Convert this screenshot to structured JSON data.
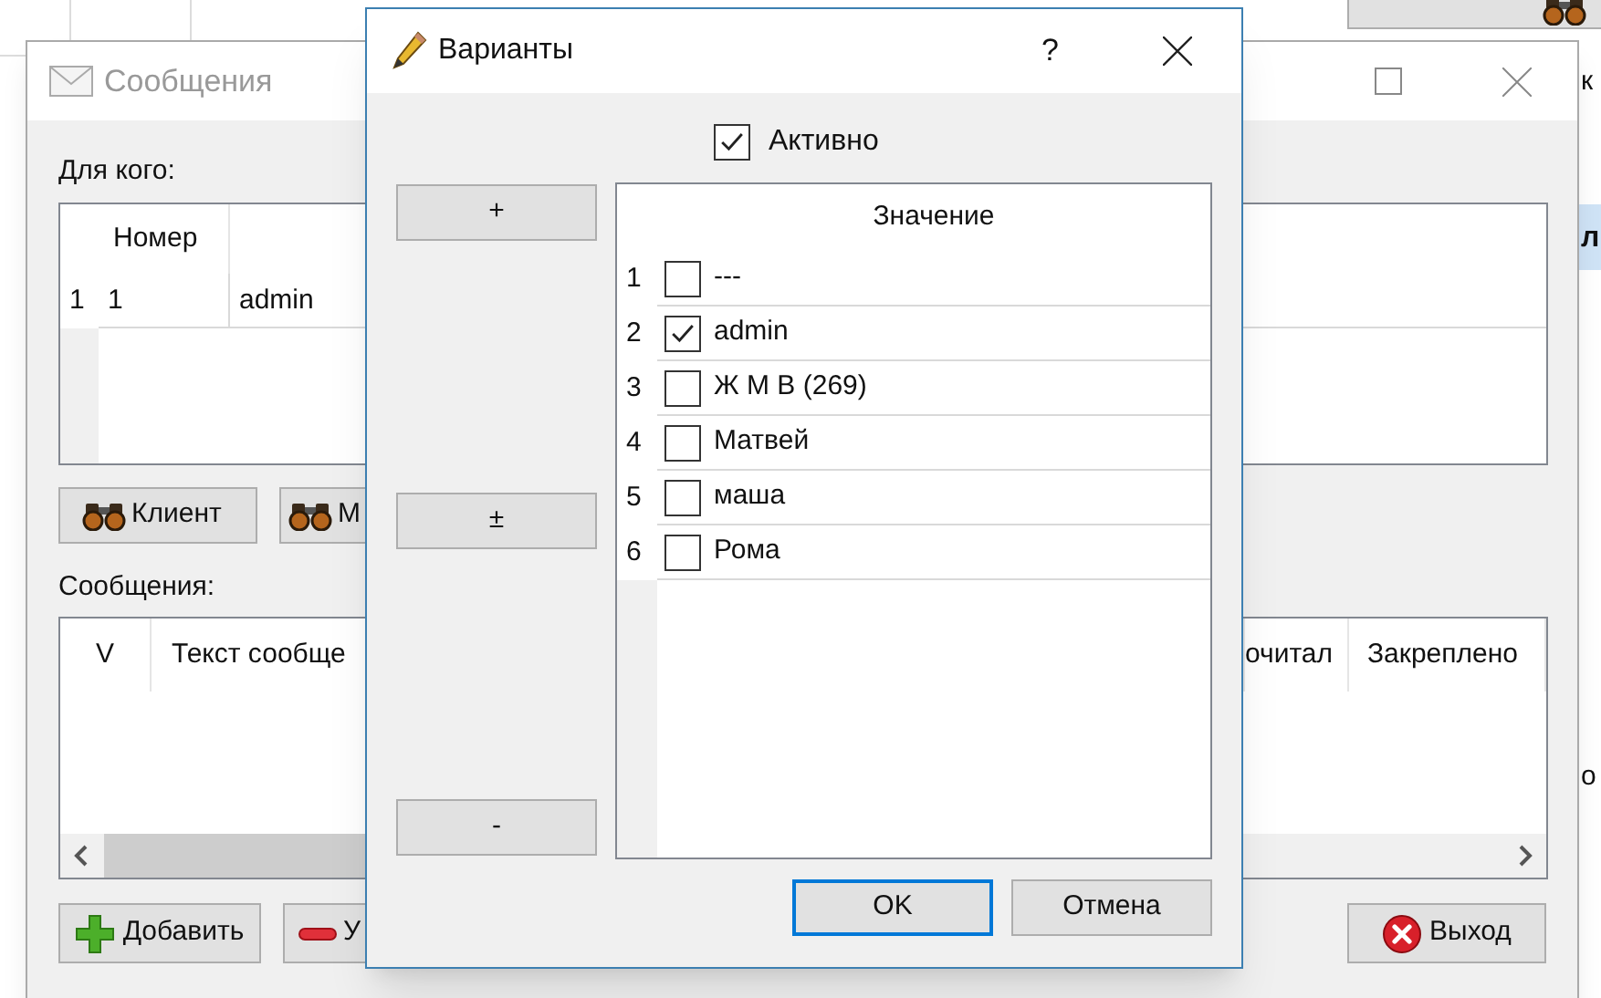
{
  "background_window": {
    "texts": [
      "к",
      "л",
      "о"
    ]
  },
  "messages_window": {
    "title": "Сообщения",
    "recipients_label": "Для кого:",
    "recipients_table": {
      "columns": [
        "Номер"
      ],
      "rows": [
        {
          "number": "1",
          "cells": [
            "1",
            "admin"
          ]
        }
      ]
    },
    "search_buttons": [
      {
        "label": "Клиент"
      },
      {
        "label": "М"
      }
    ],
    "messages_label": "Сообщения:",
    "messages_table": {
      "columns": [
        "V",
        "Текст сообще",
        "очитал",
        "Закреплено"
      ]
    },
    "bottom_buttons": [
      {
        "label": "Добавить",
        "kind": "add"
      },
      {
        "label": "У",
        "kind": "remove"
      },
      {
        "label": "Выход",
        "kind": "exit"
      }
    ]
  },
  "dialog": {
    "title": "Варианты",
    "help": "?",
    "active": {
      "label": "Активно",
      "checked": true
    },
    "side_buttons": [
      "+",
      "±",
      "-"
    ],
    "list": {
      "column": "Значение",
      "rows": [
        {
          "number": "1",
          "label": "---",
          "checked": false
        },
        {
          "number": "2",
          "label": "admin",
          "checked": true
        },
        {
          "number": "3",
          "label": "Ж М В (269)",
          "checked": false
        },
        {
          "number": "4",
          "label": "Матвей",
          "checked": false
        },
        {
          "number": "5",
          "label": "маша",
          "checked": false
        },
        {
          "number": "6",
          "label": "Рома",
          "checked": false
        }
      ]
    },
    "buttons": [
      {
        "label": "OK",
        "kind": "default"
      },
      {
        "label": "Отмена",
        "kind": "normal"
      }
    ]
  }
}
